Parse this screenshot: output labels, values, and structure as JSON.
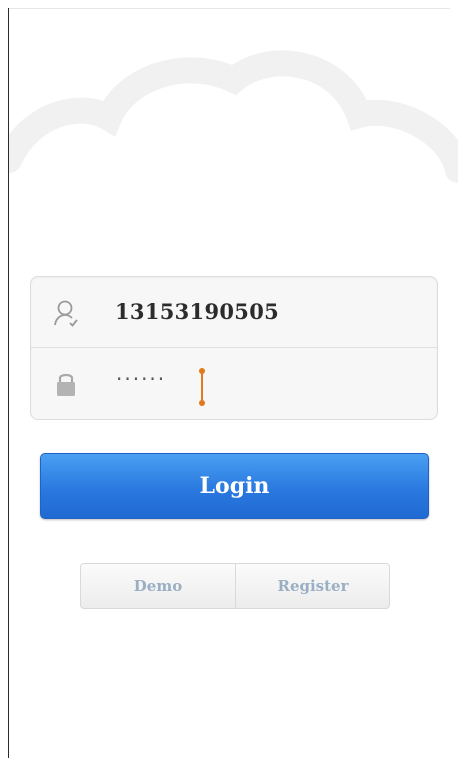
{
  "login_form": {
    "username_value": "13153190505",
    "password_masked": "······"
  },
  "login_button": {
    "label": "Login",
    "color": "#2a79e0"
  },
  "secondary_actions": {
    "demo_label": "Demo",
    "register_label": "Register"
  },
  "icons": {
    "username": "user-icon",
    "password": "lock-icon",
    "background": "cloud-icon"
  },
  "colors": {
    "accent": "#2a79e0",
    "cursor": "#e07a1a",
    "secondary_text": "#9aaec4"
  }
}
